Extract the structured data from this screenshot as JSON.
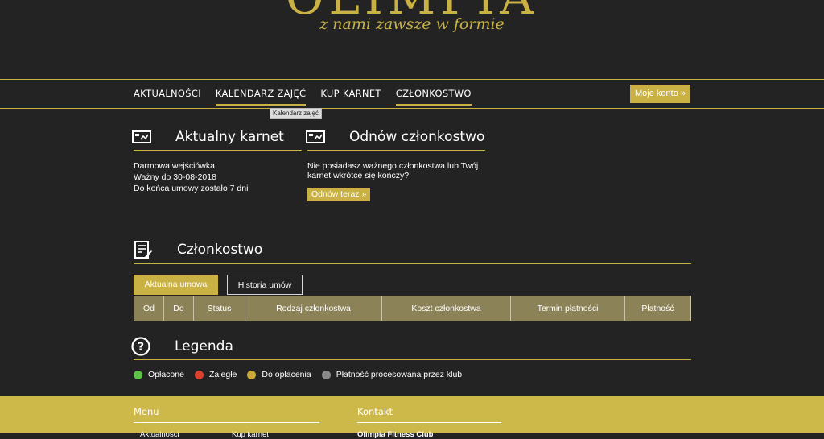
{
  "theme": {
    "background": "#232323",
    "accent": "#c9b144",
    "table_header": "#8c8258",
    "footer": "#cdb84a",
    "text": "#ffffff"
  },
  "brand": {
    "logo_text": "OLIMPIA",
    "tagline": "z nami zawsze w formie"
  },
  "nav": {
    "items": [
      {
        "label": "AKTUALNOŚCI",
        "active": false
      },
      {
        "label": "KALENDARZ ZAJĘĆ",
        "active": true
      },
      {
        "label": "KUP KARNET",
        "active": false
      },
      {
        "label": "CZŁONKOSTWO",
        "active": true
      }
    ],
    "account_button": "Moje konto »",
    "tooltip": "Kalendarz zajęć"
  },
  "current_pass": {
    "title": "Aktualny karnet",
    "icon": "card-icon",
    "lines": [
      "Darmowa wejściówka",
      "Ważny do 30-08-2018",
      "Do końca umowy zostało 7 dni"
    ]
  },
  "renew": {
    "title": "Odnów członkostwo",
    "icon": "card-icon",
    "text": "Nie posiadasz ważnego członkostwa lub Twój karnet wkrótce się kończy?",
    "button": "Odnów teraz »"
  },
  "membership": {
    "title": "Członkostwo",
    "icon": "contract-icon",
    "tabs": [
      {
        "label": "Aktualna umowa",
        "active": true
      },
      {
        "label": "Historia umów",
        "active": false
      }
    ],
    "columns": [
      "Od",
      "Do",
      "Status",
      "Rodzaj członkostwa",
      "Koszt członkostwa",
      "Termin płatności",
      "Płatność"
    ]
  },
  "legend": {
    "title": "Legenda",
    "icon": "help-icon",
    "items": [
      {
        "label": "Opłacone",
        "color": "#5cc24a"
      },
      {
        "label": "Zaległe",
        "color": "#d9402e"
      },
      {
        "label": "Do opłacenia",
        "color": "#c9a93a"
      },
      {
        "label": "Płatność procesowana przez klub",
        "color": "#8a8a8a"
      }
    ]
  },
  "footer": {
    "menu_title": "Menu",
    "contact_title": "Kontakt",
    "menu_links": [
      "Aktualności",
      "Kup karnet"
    ],
    "contact_lines": [
      "Olimpia Fitness Club"
    ]
  }
}
